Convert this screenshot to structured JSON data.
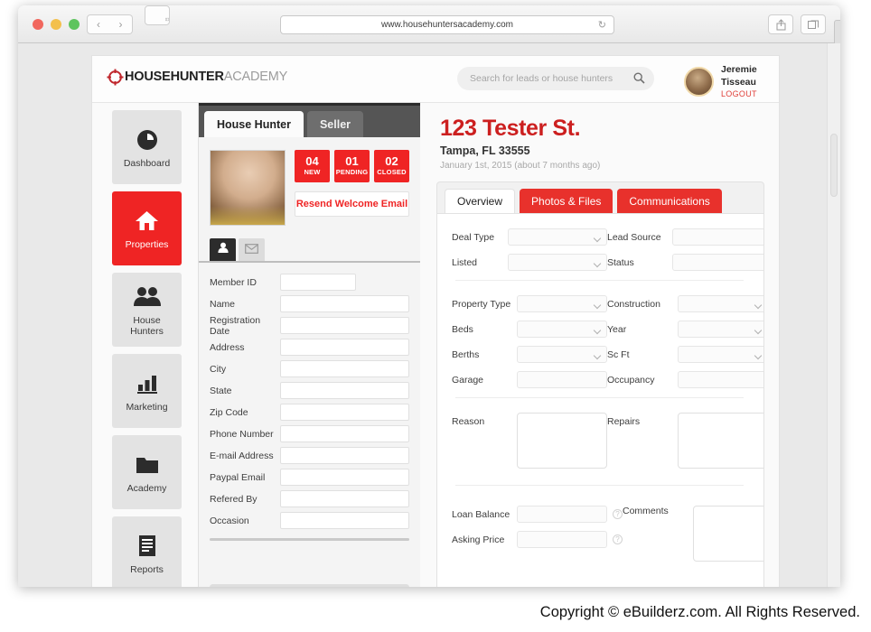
{
  "browser": {
    "url": "www.househuntersacademy.com",
    "back_label": "‹",
    "forward_label": "›",
    "sidebar_label": "sidebar-toggle",
    "reload_label": "↻",
    "share_label": "share",
    "tabs_label": "tabs",
    "newtab_label": "+"
  },
  "header": {
    "logo_bold": "HOUSEHUNTER",
    "logo_light": "ACADEMY",
    "search_placeholder": "Search for leads or house hunters",
    "search_value": "",
    "user_name": "Jeremie Tisseau",
    "logout_label": "LOGOUT"
  },
  "sidebar": {
    "items": [
      {
        "label": "Dashboard",
        "icon": "clock-icon",
        "active": false
      },
      {
        "label": "Properties",
        "icon": "home-icon",
        "active": true
      },
      {
        "label": "House\nHunters",
        "icon": "people-icon",
        "active": false
      },
      {
        "label": "Marketing",
        "icon": "bar-chart-icon",
        "active": false
      },
      {
        "label": "Academy",
        "icon": "folder-icon",
        "active": false
      },
      {
        "label": "Reports",
        "icon": "document-icon",
        "active": false
      }
    ]
  },
  "house_hunter_panel": {
    "tabs": [
      {
        "label": "House Hunter",
        "active": true
      },
      {
        "label": "Seller",
        "active": false
      }
    ],
    "badges": [
      {
        "number": "04",
        "label": "NEW"
      },
      {
        "number": "01",
        "label": "PENDING"
      },
      {
        "number": "02",
        "label": "CLOSED"
      }
    ],
    "resend_label": "Resend Welcome Email",
    "icon_tabs": [
      {
        "icon": "person-icon",
        "active": true
      },
      {
        "icon": "mail-icon",
        "active": false
      }
    ],
    "fields": [
      {
        "label": "Member ID",
        "value": "",
        "short": true
      },
      {
        "label": "Name",
        "value": "",
        "short": false
      },
      {
        "label": "Registration Date",
        "value": "",
        "short": false
      },
      {
        "label": "Address",
        "value": "",
        "short": false
      },
      {
        "label": "City",
        "value": "",
        "short": false
      },
      {
        "label": "State",
        "value": "",
        "short": false
      },
      {
        "label": "Zip Code",
        "value": "",
        "short": false
      },
      {
        "label": "Phone Number",
        "value": "",
        "short": false
      },
      {
        "label": "E-mail Address",
        "value": "",
        "short": false
      },
      {
        "label": "Paypal Email",
        "value": "",
        "short": false
      },
      {
        "label": "Refered By",
        "value": "",
        "short": false
      },
      {
        "label": "Occasion",
        "value": "",
        "short": false
      }
    ]
  },
  "property": {
    "title": "123 Tester St.",
    "location": "Tampa, FL 33555",
    "date": "January 1st, 2015 (about 7 months ago)",
    "tabs": [
      {
        "label": "Overview",
        "style": "active"
      },
      {
        "label": "Photos & Files",
        "style": "red"
      },
      {
        "label": "Communications",
        "style": "red"
      }
    ],
    "overview": {
      "group1": [
        {
          "left_label": "Deal Type",
          "left_type": "select",
          "left_value": "",
          "right_label": "Lead Source",
          "right_type": "select",
          "right_value": ""
        },
        {
          "left_label": "Listed",
          "left_type": "select",
          "left_value": "",
          "right_label": "Status",
          "right_type": "select",
          "right_value": ""
        }
      ],
      "group2": [
        {
          "left_label": "Property Type",
          "left_type": "select",
          "left_value": "",
          "right_label": "Construction",
          "right_type": "select",
          "right_value": ""
        },
        {
          "left_label": "Beds",
          "left_type": "select",
          "left_value": "",
          "right_label": "Year",
          "right_type": "select",
          "right_value": ""
        },
        {
          "left_label": "Berths",
          "left_type": "select",
          "left_value": "",
          "right_label": "Sc Ft",
          "right_type": "select",
          "right_value": ""
        },
        {
          "left_label": "Garage",
          "left_type": "input",
          "left_value": "",
          "right_label": "Occupancy",
          "right_type": "input",
          "right_value": ""
        }
      ],
      "textareas": [
        {
          "label": "Reason",
          "value": ""
        },
        {
          "label": "Repairs",
          "value": ""
        }
      ],
      "group3": [
        {
          "label": "Loan Balance",
          "value": "",
          "help": "?"
        },
        {
          "label": "Asking Price",
          "value": "",
          "help": "?"
        }
      ],
      "comments_label": "Comments",
      "comments_value": ""
    }
  },
  "footer": {
    "copyright": "Copyright © eBuilderz.com. All Rights Reserved."
  },
  "colors": {
    "brand_red": "#ef2424",
    "title_red": "#cc1f1f",
    "tab_red": "#e8312c",
    "dark_header": "#555555"
  }
}
